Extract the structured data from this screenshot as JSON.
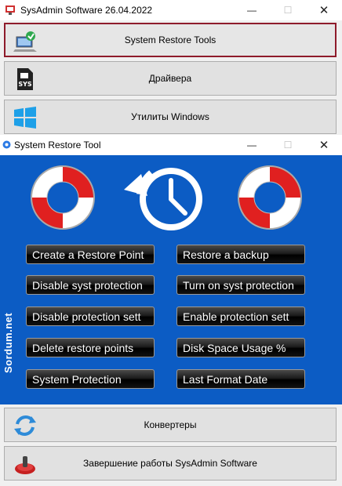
{
  "app": {
    "title": "SysAdmin Software 26.04.2022",
    "window_controls": {
      "minimize": "—",
      "maximize": "☐",
      "close": "✕"
    }
  },
  "menu": [
    {
      "label": "System Restore Tools",
      "icon": "system-restore-icon"
    },
    {
      "label": "Драйвера",
      "icon": "sys-file-icon"
    },
    {
      "label": "Утилиты Windows",
      "icon": "windows-logo-icon"
    }
  ],
  "restore_tool": {
    "title": "System Restore Tool",
    "window_controls": {
      "minimize": "—",
      "maximize": "☐",
      "close": "✕"
    },
    "sidebar_text": "Sordum.net",
    "icon_sys_label": "SYS",
    "buttons_left": [
      "Create a Restore Point",
      "Disable syst protection",
      "Disable protection sett",
      "Delete restore points",
      "System Protection"
    ],
    "buttons_right": [
      "Restore a backup",
      "Turn on syst protection",
      "Enable protection sett",
      "Disk Space Usage %",
      "Last Format Date"
    ]
  },
  "bottom": [
    {
      "label": "Конвертеры",
      "icon": "refresh-arrows-icon"
    },
    {
      "label": "Завершение работы SysAdmin Software",
      "icon": "power-icon"
    }
  ],
  "colors": {
    "accent_border": "#8e1b2b",
    "panel_blue": "#0c5cc4",
    "button_dark": "#000000",
    "lifebuoy_red": "#e02020"
  }
}
